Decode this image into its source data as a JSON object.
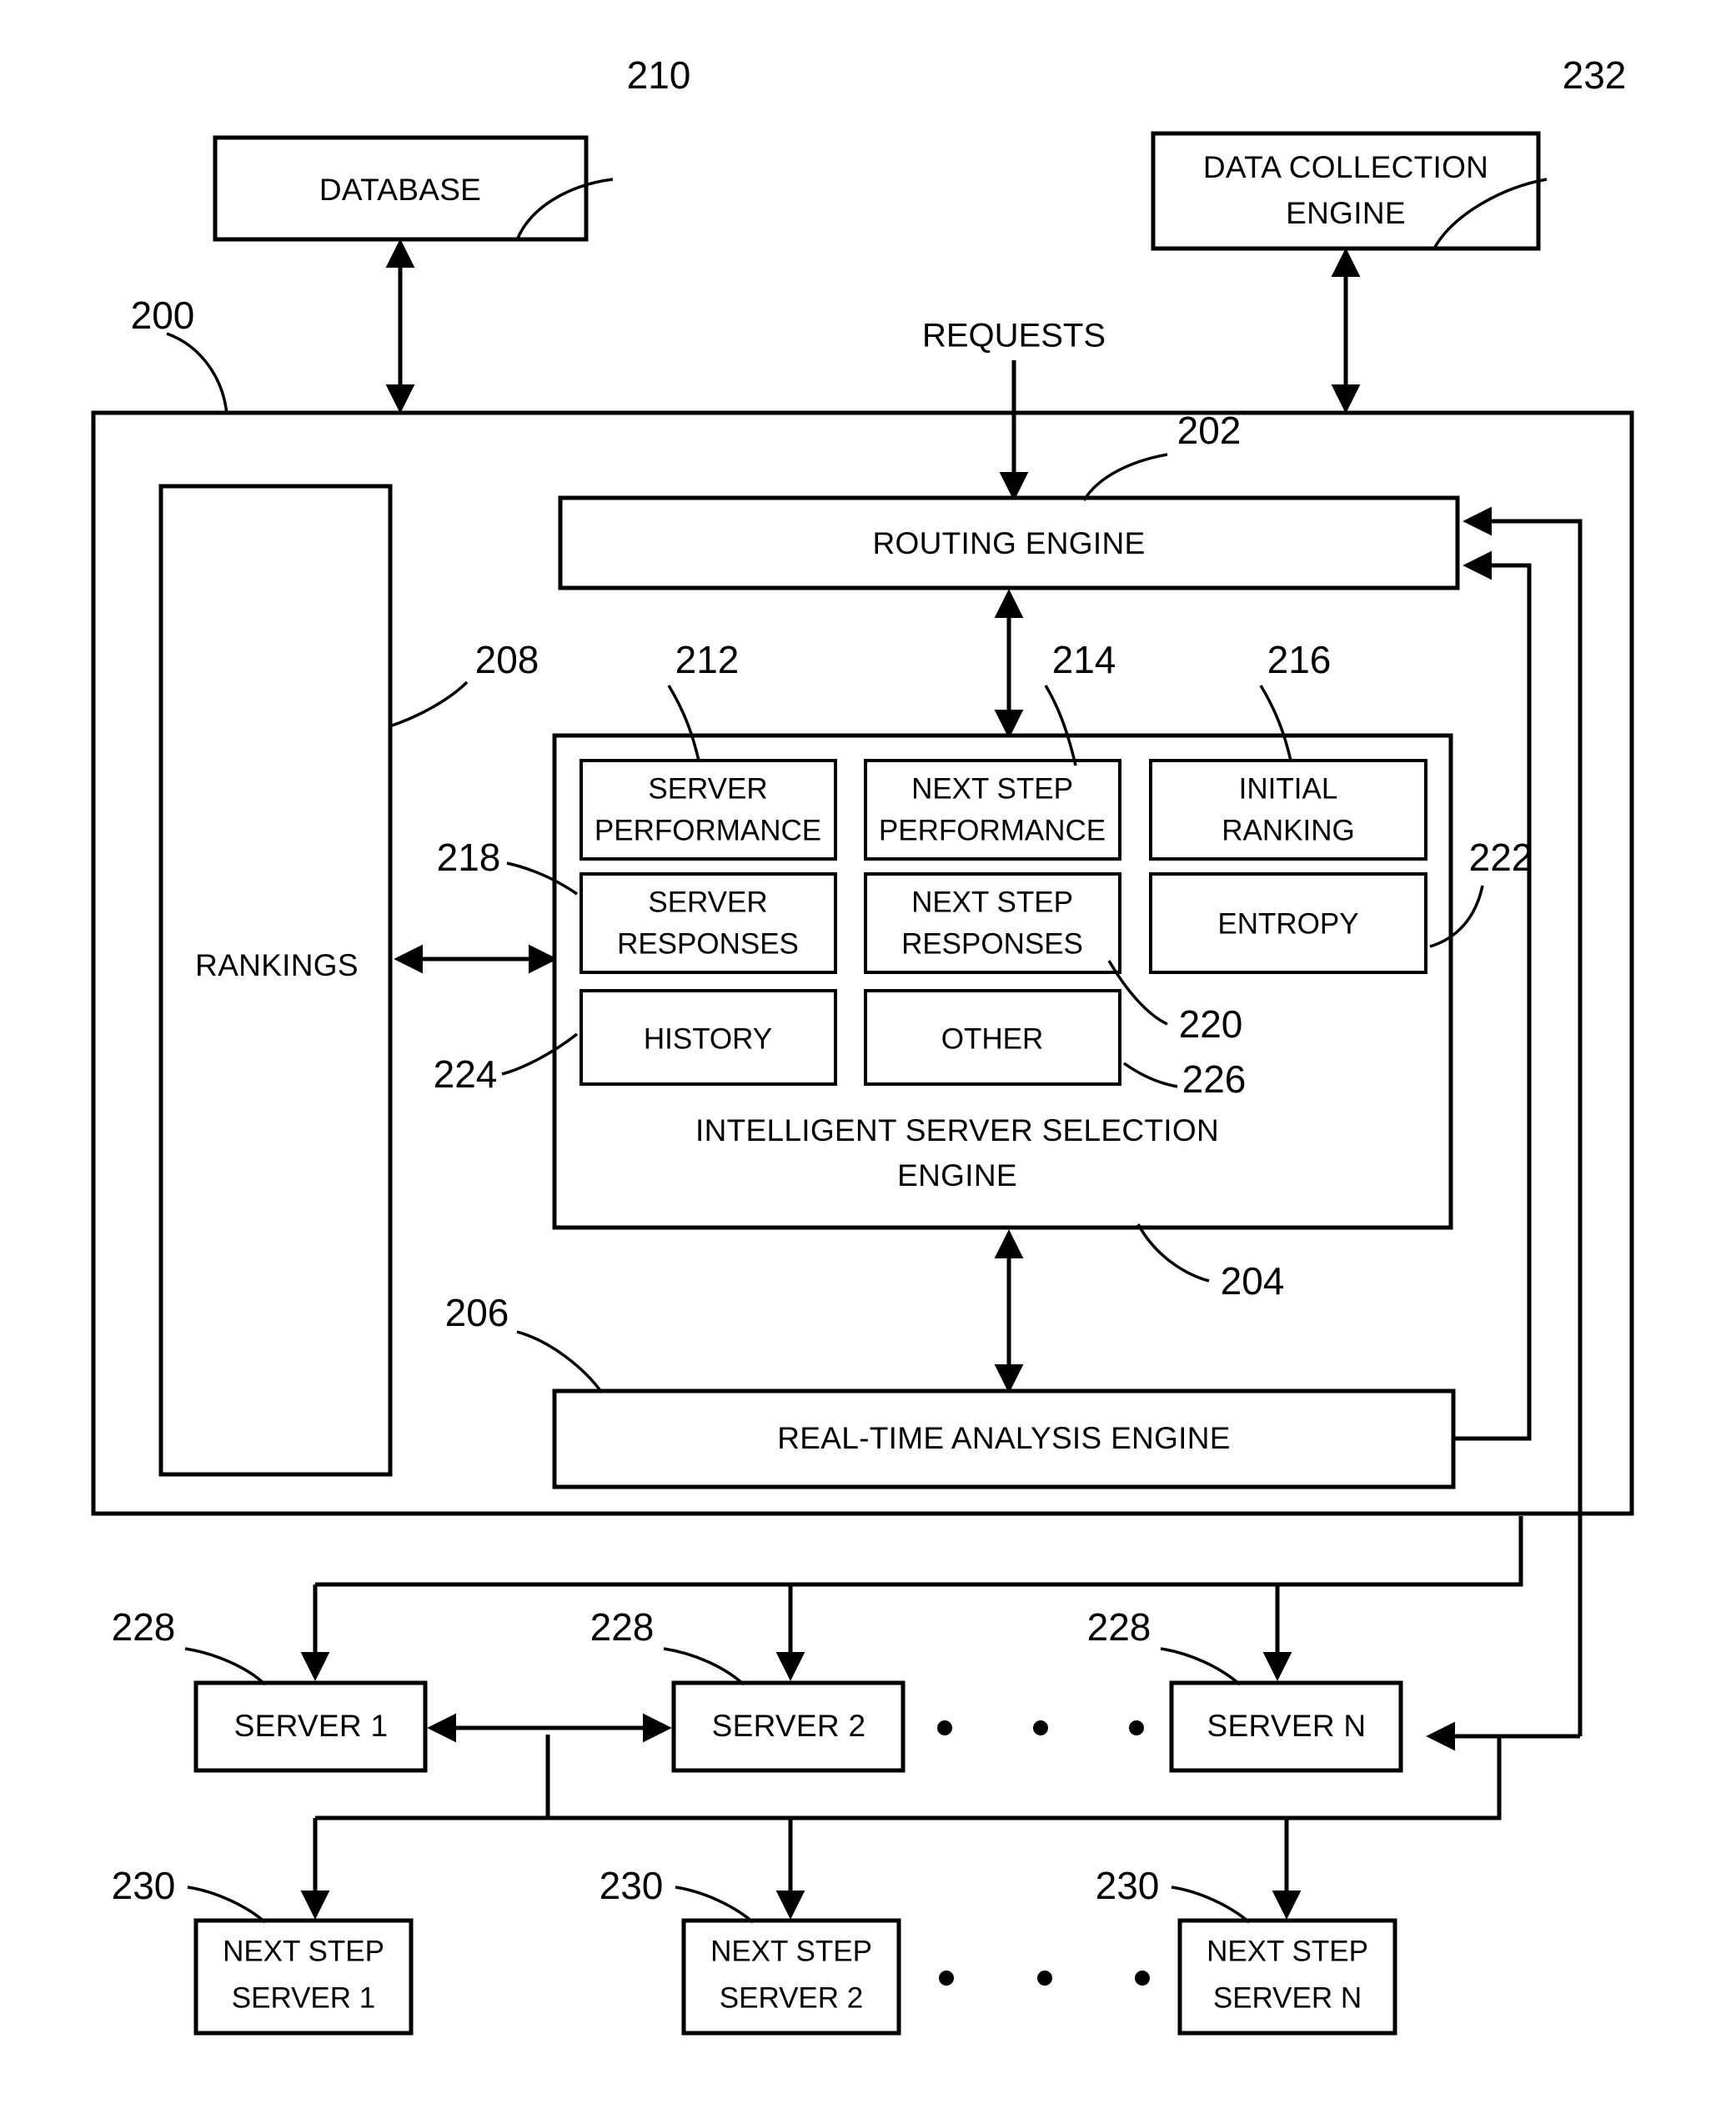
{
  "figure": {
    "style": "patent-line-drawing",
    "ink_color": "#000000",
    "background_color": "#ffffff"
  },
  "free_text": {
    "requests": "REQUESTS"
  },
  "boxes": {
    "database": {
      "label": "DATABASE",
      "ref": "210"
    },
    "data_collection_engine": {
      "label_line1": "DATA COLLECTION",
      "label_line2": "ENGINE",
      "ref": "232"
    },
    "system": {
      "ref": "200"
    },
    "routing_engine": {
      "label": "ROUTING ENGINE",
      "ref": "202"
    },
    "rankings": {
      "label": "RANKINGS",
      "ref": "208"
    },
    "selection_engine": {
      "label_line1": "INTELLIGENT SERVER SELECTION",
      "label_line2": "ENGINE",
      "ref": "204"
    },
    "real_time_analysis_engine": {
      "label": "REAL-TIME ANALYSIS ENGINE",
      "ref": "206"
    }
  },
  "selection_engine_tiles": [
    {
      "label_line1": "SERVER",
      "label_line2": "PERFORMANCE",
      "ref": "212"
    },
    {
      "label_line1": "NEXT STEP",
      "label_line2": "PERFORMANCE",
      "ref": "214"
    },
    {
      "label_line1": "INITIAL",
      "label_line2": "RANKING",
      "ref": "216"
    },
    {
      "label_line1": "SERVER",
      "label_line2": "RESPONSES",
      "ref": "218"
    },
    {
      "label_line1": "NEXT STEP",
      "label_line2": "RESPONSES",
      "ref": "220"
    },
    {
      "label_line1": "ENTROPY",
      "label_line2": "",
      "ref": "222"
    },
    {
      "label_line1": "HISTORY",
      "label_line2": "",
      "ref": "224"
    },
    {
      "label_line1": "OTHER",
      "label_line2": "",
      "ref": "226"
    }
  ],
  "servers": {
    "ref": "228",
    "items": [
      {
        "label": "SERVER 1",
        "ref": "228"
      },
      {
        "label": "SERVER 2",
        "ref": "228"
      },
      {
        "label": "SERVER N",
        "ref": "228"
      }
    ],
    "ellipsis": "•"
  },
  "next_step_servers": {
    "ref": "230",
    "items": [
      {
        "label_line1": "NEXT STEP",
        "label_line2": "SERVER 1",
        "ref": "230"
      },
      {
        "label_line1": "NEXT STEP",
        "label_line2": "SERVER 2",
        "ref": "230"
      },
      {
        "label_line1": "NEXT STEP",
        "label_line2": "SERVER N",
        "ref": "230"
      }
    ],
    "ellipsis": "•"
  },
  "reference_numerals": [
    "200",
    "202",
    "204",
    "206",
    "208",
    "210",
    "212",
    "214",
    "216",
    "218",
    "220",
    "222",
    "224",
    "226",
    "228",
    "230",
    "232"
  ]
}
